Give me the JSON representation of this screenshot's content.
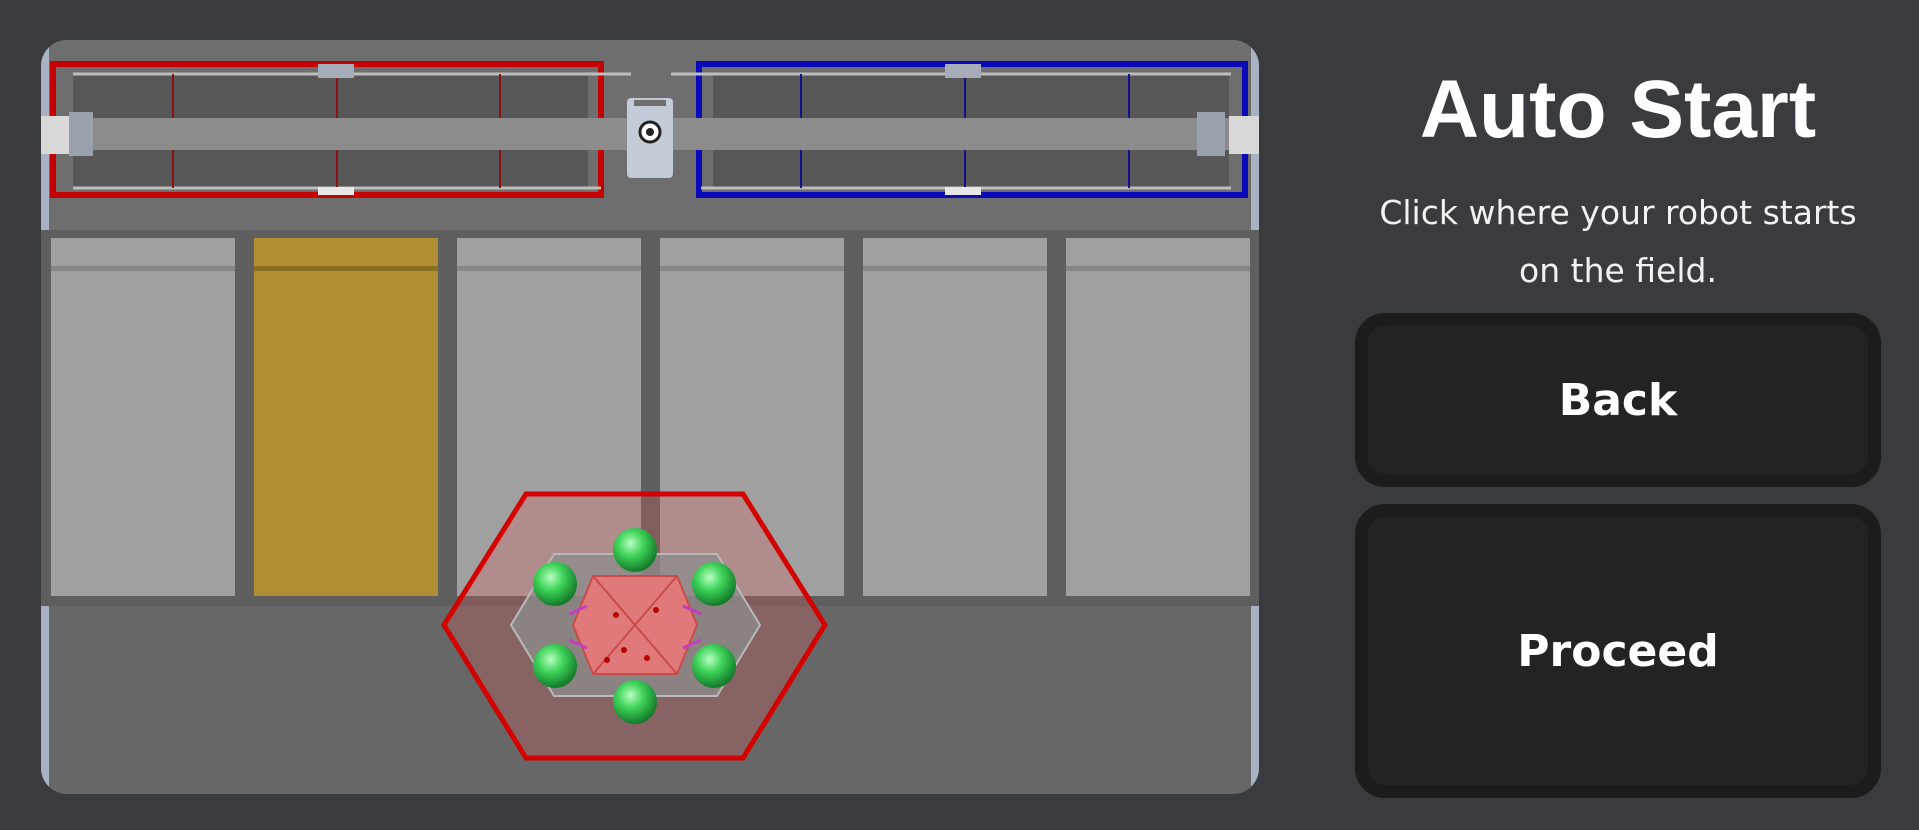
{
  "page": {
    "title": "Auto Start",
    "instructions": "Click where your robot starts on the field."
  },
  "buttons": {
    "back_label": "Back",
    "proceed_label": "Proceed"
  },
  "field": {
    "zone_count": 6,
    "selected_zone_index": 1,
    "selected_zone_color": "#b08f35",
    "zone_color": "#a0a0a0",
    "red_alliance_color": "#c40000",
    "blue_alliance_color": "#0a0ab8",
    "robot_marker_color": "#d91e1e"
  }
}
